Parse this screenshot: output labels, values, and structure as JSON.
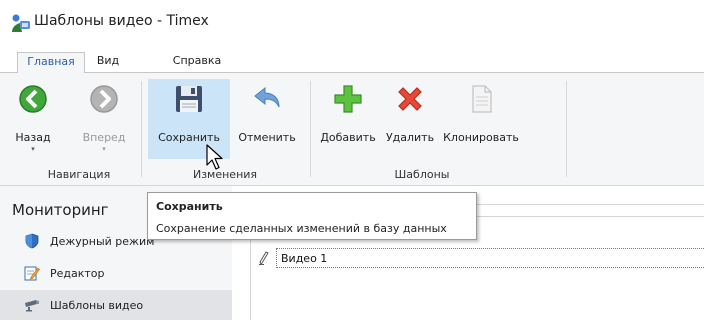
{
  "window": {
    "title": "Шаблоны видео - Timex"
  },
  "tabs": [
    {
      "label": "Главная",
      "active": true
    },
    {
      "label": "Вид",
      "active": false
    },
    {
      "label": "Справка",
      "active": false
    }
  ],
  "ribbon": {
    "groups": [
      {
        "label": "Навигация"
      },
      {
        "label": "Изменения"
      },
      {
        "label": "Шаблоны"
      }
    ],
    "buttons": {
      "back": {
        "label": "Назад",
        "drop": "▾",
        "icon": "back-arrow-icon"
      },
      "forward": {
        "label": "Вперед",
        "drop": "▾",
        "icon": "forward-arrow-icon",
        "disabled": true
      },
      "save": {
        "label": "Сохранить",
        "icon": "floppy-disk-icon"
      },
      "undo": {
        "label": "Отменить",
        "icon": "undo-arrow-icon"
      },
      "add": {
        "label": "Добавить",
        "icon": "green-plus-icon"
      },
      "delete": {
        "label": "Удалить",
        "icon": "red-x-icon"
      },
      "clone": {
        "label": "Клонировать",
        "icon": "document-icon",
        "disabled": true
      }
    }
  },
  "sidebar": {
    "title": "Мониторинг",
    "items": [
      {
        "label": "Дежурный режим",
        "icon": "shield-icon"
      },
      {
        "label": "Редактор",
        "icon": "edit-icon"
      },
      {
        "label": "Шаблоны видео",
        "icon": "camera-icon",
        "selected": true
      }
    ]
  },
  "grid": {
    "row_value": "Видео 1"
  },
  "tooltip": {
    "title": "Сохранить",
    "body": "Сохранение сделанных изменений в базу данных"
  },
  "colors": {
    "accent": "#2b5fa8",
    "ribbon_bg": "#f5f6f7",
    "hover": "#cce4f7"
  }
}
